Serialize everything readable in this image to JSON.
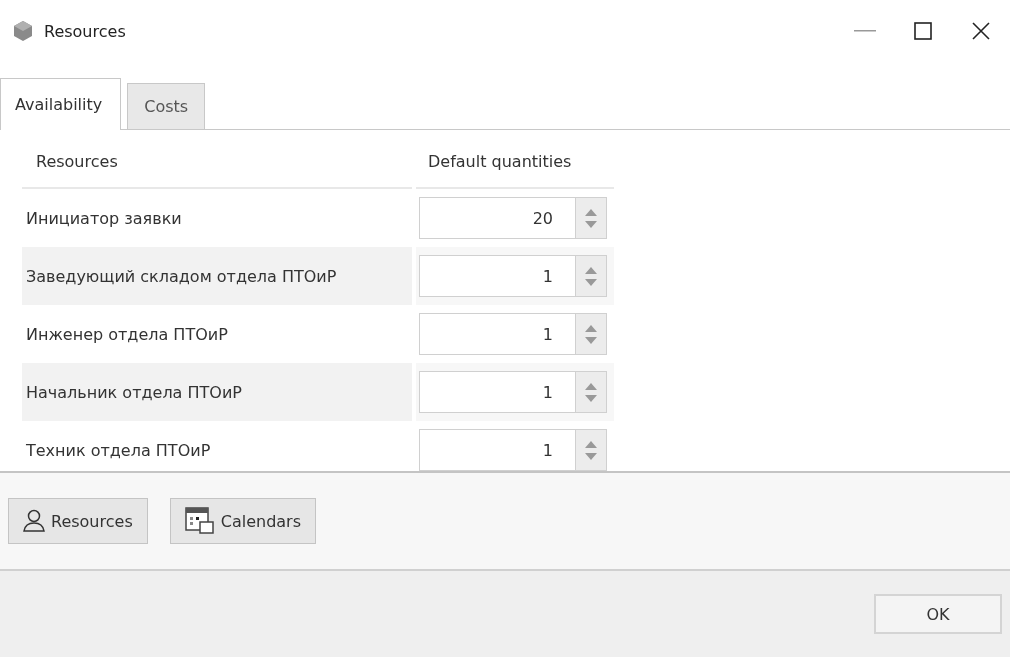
{
  "window": {
    "title": "Resources"
  },
  "tabs": [
    {
      "label": "Availability",
      "selected": true
    },
    {
      "label": "Costs",
      "selected": false
    }
  ],
  "table": {
    "columns": [
      "Resources",
      "Default quantities"
    ],
    "rows": [
      {
        "resource": "Инициатор заявки",
        "quantity": "20"
      },
      {
        "resource": "Заведующий складом отдела ПТОиР",
        "quantity": "1"
      },
      {
        "resource": "Инженер отдела ПТОиР",
        "quantity": "1"
      },
      {
        "resource": "Начальник отдела ПТОиР",
        "quantity": "1"
      },
      {
        "resource": "Техник отдела ПТОиР",
        "quantity": "1"
      }
    ]
  },
  "toolbar": [
    {
      "kind": "person",
      "label": "Resources"
    },
    {
      "kind": "calendar",
      "label": "Calendars"
    }
  ],
  "buttons": [
    "OK"
  ]
}
